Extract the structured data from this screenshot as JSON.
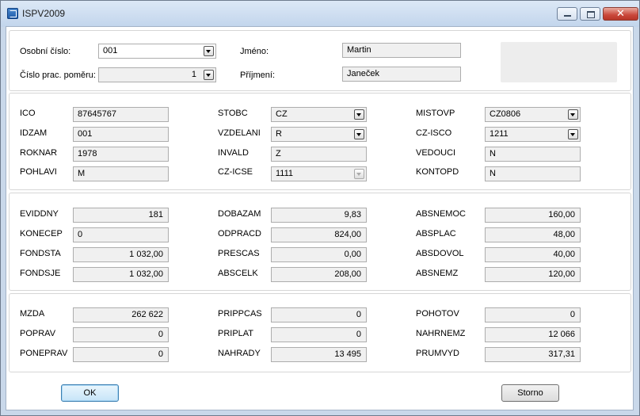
{
  "window": {
    "title": "ISPV2009",
    "minimize_icon": "minimize-icon",
    "maximize_icon": "maximize-icon",
    "close_glyph": "✕"
  },
  "header": {
    "osobni_cislo": {
      "label": "Osobní číslo:",
      "value": "001"
    },
    "cislo_pp": {
      "label": "Číslo prac. poměru:",
      "value": "1"
    },
    "jmeno": {
      "label": "Jméno:",
      "value": "Martin"
    },
    "prijmeni": {
      "label": "Příjmení:",
      "value": "Janeček"
    }
  },
  "section1": {
    "ico": {
      "label": "ICO",
      "value": "87645767"
    },
    "idzam": {
      "label": "IDZAM",
      "value": "001"
    },
    "roknar": {
      "label": "ROKNAR",
      "value": "1978"
    },
    "pohlavi": {
      "label": "POHLAVI",
      "value": "M"
    },
    "stobc": {
      "label": "STOBC",
      "value": "CZ"
    },
    "vzdelani": {
      "label": "VZDELANI",
      "value": "R"
    },
    "invald": {
      "label": "INVALD",
      "value": "Z"
    },
    "czicse": {
      "label": "CZ-ICSE",
      "value": "1111"
    },
    "mistovp": {
      "label": "MISTOVP",
      "value": "CZ0806"
    },
    "czisco": {
      "label": "CZ-ISCO",
      "value": "1211"
    },
    "vedouci": {
      "label": "VEDOUCI",
      "value": "N"
    },
    "kontopd": {
      "label": "KONTOPD",
      "value": "N"
    }
  },
  "section2": {
    "evidny": {
      "label": "EVIDDNY",
      "value": "181"
    },
    "konecep": {
      "label": "KONECEP",
      "value": "0"
    },
    "fondsta": {
      "label": "FONDSTA",
      "value": "1 032,00"
    },
    "fondsje": {
      "label": "FONDSJE",
      "value": "1 032,00"
    },
    "dobazam": {
      "label": "DOBAZAM",
      "value": "9,83"
    },
    "odpracd": {
      "label": "ODPRACD",
      "value": "824,00"
    },
    "prescas": {
      "label": "PRESCAS",
      "value": "0,00"
    },
    "abscelk": {
      "label": "ABSCELK",
      "value": "208,00"
    },
    "absnemoc": {
      "label": "ABSNEMOC",
      "value": "160,00"
    },
    "absplac": {
      "label": "ABSPLAC",
      "value": "48,00"
    },
    "absdovol": {
      "label": "ABSDOVOL",
      "value": "40,00"
    },
    "absnemz": {
      "label": "ABSNEMZ",
      "value": "120,00"
    }
  },
  "section3": {
    "mzda": {
      "label": "MZDA",
      "value": "262 622"
    },
    "poprav": {
      "label": "POPRAV",
      "value": "0"
    },
    "poneprav": {
      "label": "PONEPRAV",
      "value": "0"
    },
    "prippcas": {
      "label": "PRIPPCAS",
      "value": "0"
    },
    "priplat": {
      "label": "PRIPLAT",
      "value": "0"
    },
    "nahrady": {
      "label": "NAHRADY",
      "value": "13 495"
    },
    "pohotov": {
      "label": "POHOTOV",
      "value": "0"
    },
    "nahrnemz": {
      "label": "NAHRNEMZ",
      "value": "12 066"
    },
    "prumvyd": {
      "label": "PRUMVYD",
      "value": "317,31"
    }
  },
  "buttons": {
    "ok": "OK",
    "storno": "Storno"
  }
}
